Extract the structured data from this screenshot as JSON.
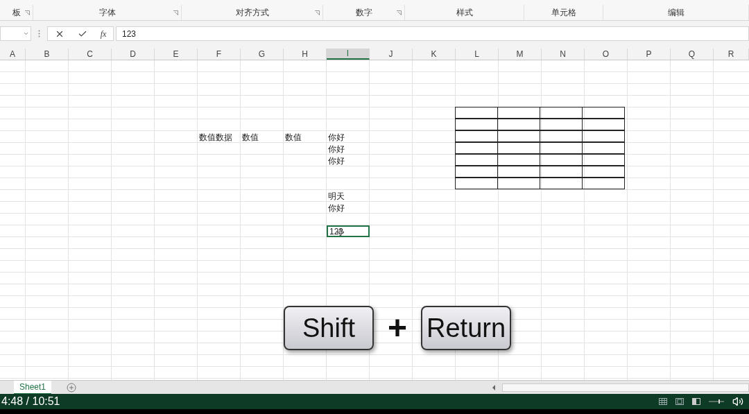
{
  "ribbon_groups": [
    {
      "label": "板",
      "launcher": true
    },
    {
      "label": "字体",
      "launcher": true
    },
    {
      "label": "对齐方式",
      "launcher": true
    },
    {
      "label": "数字",
      "launcher": true
    },
    {
      "label": "样式",
      "launcher": false
    },
    {
      "label": "单元格",
      "launcher": false
    },
    {
      "label": "编辑",
      "launcher": false
    }
  ],
  "formula_bar": {
    "function_label": "fx",
    "value": "123"
  },
  "columns": [
    {
      "letter": "A",
      "selected": false
    },
    {
      "letter": "B",
      "selected": false
    },
    {
      "letter": "C",
      "selected": false
    },
    {
      "letter": "D",
      "selected": false
    },
    {
      "letter": "E",
      "selected": false
    },
    {
      "letter": "F",
      "selected": false
    },
    {
      "letter": "G",
      "selected": false
    },
    {
      "letter": "H",
      "selected": false
    },
    {
      "letter": "I",
      "selected": true
    },
    {
      "letter": "J",
      "selected": false
    },
    {
      "letter": "K",
      "selected": false
    },
    {
      "letter": "L",
      "selected": false
    },
    {
      "letter": "M",
      "selected": false
    },
    {
      "letter": "N",
      "selected": false
    },
    {
      "letter": "O",
      "selected": false
    },
    {
      "letter": "P",
      "selected": false
    },
    {
      "letter": "Q",
      "selected": false
    },
    {
      "letter": "R",
      "selected": false
    }
  ],
  "rows": [
    {
      "cells": []
    },
    {
      "cells": []
    },
    {
      "cells": []
    },
    {
      "cells": []
    },
    {
      "cells": [
        {
          "active": false,
          "bordered": false
        },
        {
          "active": false,
          "bordered": false
        },
        {
          "active": false,
          "bordered": false
        },
        {
          "active": false,
          "bordered": false
        },
        {
          "active": false,
          "bordered": false
        },
        {
          "active": false,
          "bordered": false
        },
        {
          "active": false,
          "bordered": false
        },
        {
          "active": false,
          "bordered": false
        },
        {
          "active": false,
          "bordered": false
        },
        {
          "active": false,
          "bordered": false
        },
        {
          "active": false,
          "bordered": false
        },
        {
          "active": false,
          "bordered": true
        },
        {
          "active": false,
          "bordered": true
        },
        {
          "active": false,
          "bordered": true
        },
        {
          "active": false,
          "bordered": true
        }
      ]
    },
    {
      "cells": [
        {
          "active": false,
          "bordered": false
        },
        {
          "active": false,
          "bordered": false
        },
        {
          "active": false,
          "bordered": false
        },
        {
          "active": false,
          "bordered": false
        },
        {
          "active": false,
          "bordered": false
        },
        {
          "active": false,
          "bordered": false
        },
        {
          "active": false,
          "bordered": false
        },
        {
          "active": false,
          "bordered": false
        },
        {
          "active": false,
          "bordered": false
        },
        {
          "active": false,
          "bordered": false
        },
        {
          "active": false,
          "bordered": false
        },
        {
          "active": false,
          "bordered": true
        },
        {
          "active": false,
          "bordered": true
        },
        {
          "active": false,
          "bordered": true
        },
        {
          "active": false,
          "bordered": true
        }
      ]
    },
    {
      "cells": [
        {
          "active": false,
          "bordered": false
        },
        {
          "active": false,
          "bordered": false
        },
        {
          "active": false,
          "bordered": false
        },
        {
          "active": false,
          "bordered": false
        },
        {
          "active": false,
          "bordered": false
        },
        {
          "text": "数值数据",
          "active": false,
          "bordered": false
        },
        {
          "text": "数值",
          "active": false,
          "bordered": false
        },
        {
          "text": "数值",
          "active": false,
          "bordered": false
        },
        {
          "text": "你好",
          "active": false,
          "bordered": false
        },
        {
          "active": false,
          "bordered": false
        },
        {
          "active": false,
          "bordered": false
        },
        {
          "active": false,
          "bordered": true
        },
        {
          "active": false,
          "bordered": true
        },
        {
          "active": false,
          "bordered": true
        },
        {
          "active": false,
          "bordered": true
        }
      ]
    },
    {
      "cells": [
        {
          "active": false,
          "bordered": false
        },
        {
          "active": false,
          "bordered": false
        },
        {
          "active": false,
          "bordered": false
        },
        {
          "active": false,
          "bordered": false
        },
        {
          "active": false,
          "bordered": false
        },
        {
          "active": false,
          "bordered": false
        },
        {
          "active": false,
          "bordered": false
        },
        {
          "active": false,
          "bordered": false
        },
        {
          "text": "你好",
          "active": false,
          "bordered": false
        },
        {
          "active": false,
          "bordered": false
        },
        {
          "active": false,
          "bordered": false
        },
        {
          "active": false,
          "bordered": true
        },
        {
          "active": false,
          "bordered": true
        },
        {
          "active": false,
          "bordered": true
        },
        {
          "active": false,
          "bordered": true
        }
      ]
    },
    {
      "cells": [
        {
          "active": false,
          "bordered": false
        },
        {
          "active": false,
          "bordered": false
        },
        {
          "active": false,
          "bordered": false
        },
        {
          "active": false,
          "bordered": false
        },
        {
          "active": false,
          "bordered": false
        },
        {
          "active": false,
          "bordered": false
        },
        {
          "active": false,
          "bordered": false
        },
        {
          "active": false,
          "bordered": false
        },
        {
          "text": "你好",
          "active": false,
          "bordered": false
        },
        {
          "active": false,
          "bordered": false
        },
        {
          "active": false,
          "bordered": false
        },
        {
          "active": false,
          "bordered": true
        },
        {
          "active": false,
          "bordered": true
        },
        {
          "active": false,
          "bordered": true
        },
        {
          "active": false,
          "bordered": true
        }
      ]
    },
    {
      "cells": [
        {
          "active": false,
          "bordered": false
        },
        {
          "active": false,
          "bordered": false
        },
        {
          "active": false,
          "bordered": false
        },
        {
          "active": false,
          "bordered": false
        },
        {
          "active": false,
          "bordered": false
        },
        {
          "active": false,
          "bordered": false
        },
        {
          "active": false,
          "bordered": false
        },
        {
          "active": false,
          "bordered": false
        },
        {
          "active": false,
          "bordered": false
        },
        {
          "active": false,
          "bordered": false
        },
        {
          "active": false,
          "bordered": false
        },
        {
          "active": false,
          "bordered": true
        },
        {
          "active": false,
          "bordered": true
        },
        {
          "active": false,
          "bordered": true
        },
        {
          "active": false,
          "bordered": true
        }
      ]
    },
    {
      "cells": [
        {
          "active": false,
          "bordered": false
        },
        {
          "active": false,
          "bordered": false
        },
        {
          "active": false,
          "bordered": false
        },
        {
          "active": false,
          "bordered": false
        },
        {
          "active": false,
          "bordered": false
        },
        {
          "active": false,
          "bordered": false
        },
        {
          "active": false,
          "bordered": false
        },
        {
          "active": false,
          "bordered": false
        },
        {
          "active": false,
          "bordered": false
        },
        {
          "active": false,
          "bordered": false
        },
        {
          "active": false,
          "bordered": false
        },
        {
          "active": false,
          "bordered": true
        },
        {
          "active": false,
          "bordered": true
        },
        {
          "active": false,
          "bordered": true
        },
        {
          "active": false,
          "bordered": true
        }
      ]
    },
    {
      "cells": [
        {
          "active": false,
          "bordered": false
        },
        {
          "active": false,
          "bordered": false
        },
        {
          "active": false,
          "bordered": false
        },
        {
          "active": false,
          "bordered": false
        },
        {
          "active": false,
          "bordered": false
        },
        {
          "active": false,
          "bordered": false
        },
        {
          "active": false,
          "bordered": false
        },
        {
          "active": false,
          "bordered": false
        },
        {
          "text": "明天",
          "active": false,
          "bordered": false
        }
      ]
    },
    {
      "cells": [
        {
          "active": false,
          "bordered": false
        },
        {
          "active": false,
          "bordered": false
        },
        {
          "active": false,
          "bordered": false
        },
        {
          "active": false,
          "bordered": false
        },
        {
          "active": false,
          "bordered": false
        },
        {
          "active": false,
          "bordered": false
        },
        {
          "active": false,
          "bordered": false
        },
        {
          "active": false,
          "bordered": false
        },
        {
          "text": "你好",
          "active": false,
          "bordered": false
        }
      ]
    },
    {
      "cells": []
    },
    {
      "cells": [
        {
          "active": false,
          "bordered": false
        },
        {
          "active": false,
          "bordered": false
        },
        {
          "active": false,
          "bordered": false
        },
        {
          "active": false,
          "bordered": false
        },
        {
          "active": false,
          "bordered": false
        },
        {
          "active": false,
          "bordered": false
        },
        {
          "active": false,
          "bordered": false
        },
        {
          "active": false,
          "bordered": false
        },
        {
          "text": "123",
          "active": true,
          "bordered": false
        }
      ]
    }
  ],
  "key_overlay": {
    "keys": [
      "Shift",
      "Return"
    ],
    "joiner": "+"
  },
  "sheet_tabs": [
    {
      "label": "Sheet1",
      "selected": true
    }
  ],
  "video": {
    "time": "4:48 / 10:51"
  }
}
